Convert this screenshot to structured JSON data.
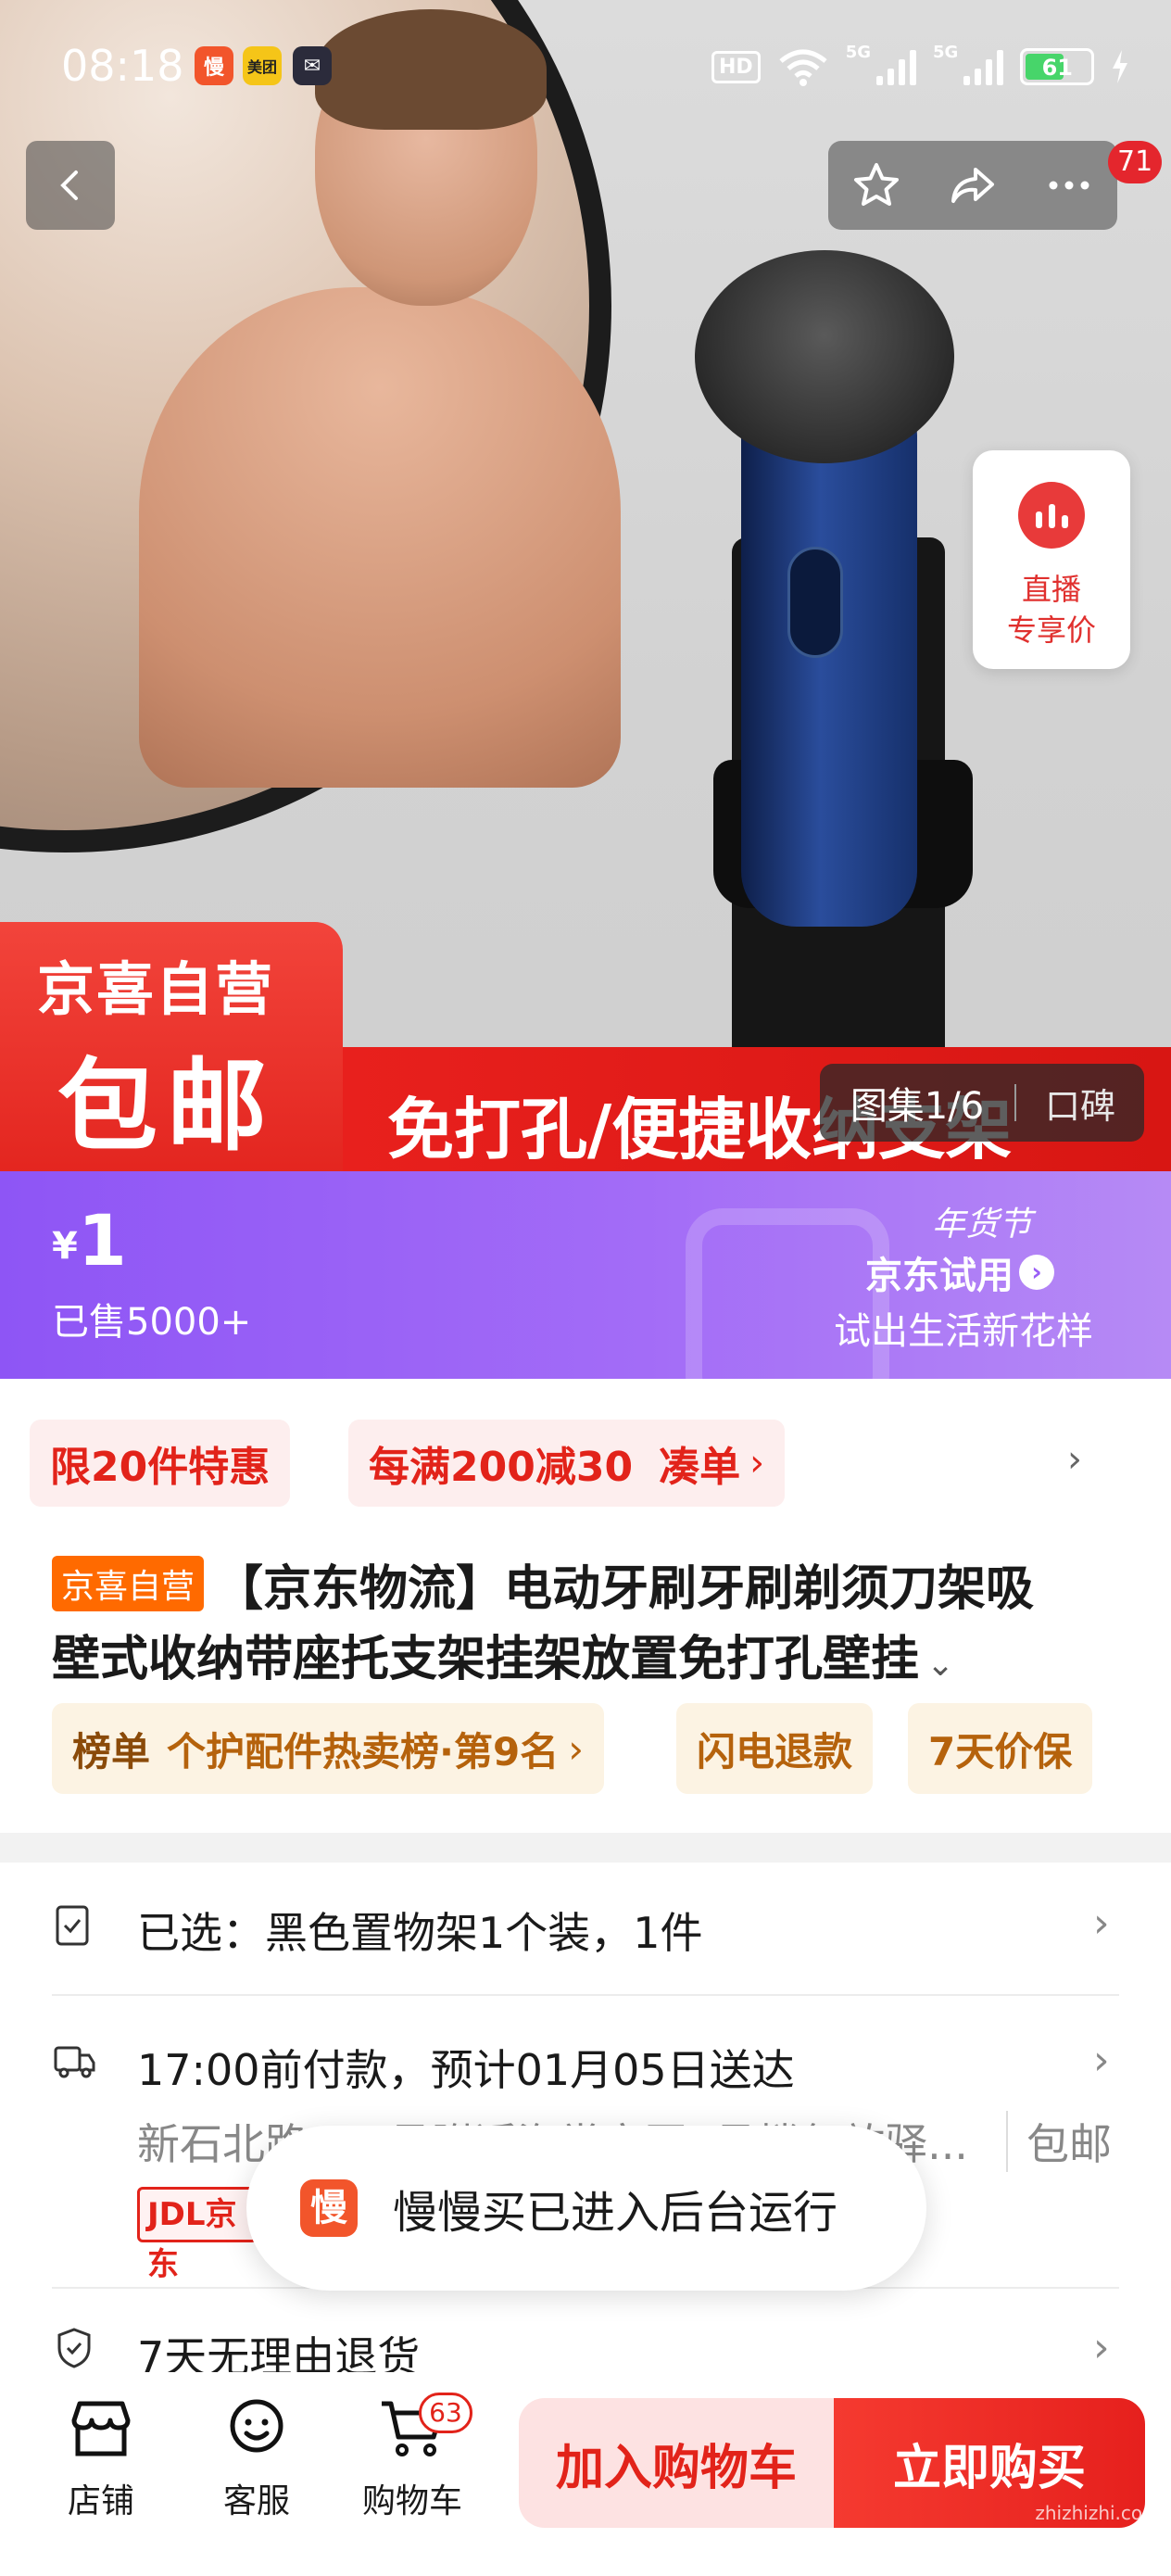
{
  "status_bar": {
    "time": "08:18",
    "apps": [
      {
        "name": "manmanmai-app",
        "glyph": "慢",
        "color": "#f2552b"
      },
      {
        "name": "meituan-app",
        "glyph": "美团",
        "color": "#f5c518"
      },
      {
        "name": "mail-app",
        "glyph": "✉",
        "color": "#2b2b3b"
      }
    ],
    "hd": "HD",
    "network_1": "5G",
    "network_2": "5G",
    "battery": "61",
    "battery_level": 0.61
  },
  "nav": {
    "cart_badge_count": "71"
  },
  "hero": {
    "live_label_1": "直播",
    "live_label_2": "专享价",
    "banner_brand": "京喜自营",
    "banner_shipping": "包邮",
    "banner_slogan": "免打孔/便捷收纳支架",
    "gallery_counter": "图集1/6",
    "gallery_kb": "口碑"
  },
  "price": {
    "currency": "¥",
    "amount": "1",
    "sold": "已售5000+",
    "trial_festival": "年货节",
    "trial_name": "京东试用",
    "trial_slogan": "试出生活新花样"
  },
  "promo": {
    "chip1": "限20件特惠",
    "chip2_main": "每满200减30",
    "chip2_link": "凑单",
    "chip2_arrow": "›",
    "row_arrow": "›"
  },
  "product": {
    "tag": "京喜自营",
    "title_line1": "【京东物流】电动牙刷牙刷剃须刀架吸",
    "title_line2": "壁式收纳带座托支架挂架放置免打孔壁挂",
    "expand": "⌄",
    "rank_label": "榜单",
    "rank_text": "个护配件热卖榜·第9名",
    "rank_arrow": "›",
    "badge_refund": "闪电退款",
    "badge_price": "7天价保"
  },
  "selection": {
    "selected": "已选：黑色置物架1个装，1件",
    "delivery": "17:00前付款，预计01月05日送达",
    "address": "新石北路275号附近海棠家园8号楼忽放驿...",
    "shipping": "包邮",
    "carrier": "JDL京东",
    "returns": "7天无理由退货",
    "arrow": "›"
  },
  "toast": {
    "icon": "慢",
    "text": "慢慢买已进入后台运行"
  },
  "bottom_bar": {
    "shop": "店铺",
    "service": "客服",
    "cart": "购物车",
    "cart_count": "63",
    "add_to_cart": "加入购物车",
    "buy_now": "立即购买"
  },
  "watermark": "zhizhizhi.com",
  "colors": {
    "accent_red": "#e2231a",
    "price_purple": "#9a5ff6",
    "orange_tag": "#ff6a00"
  }
}
